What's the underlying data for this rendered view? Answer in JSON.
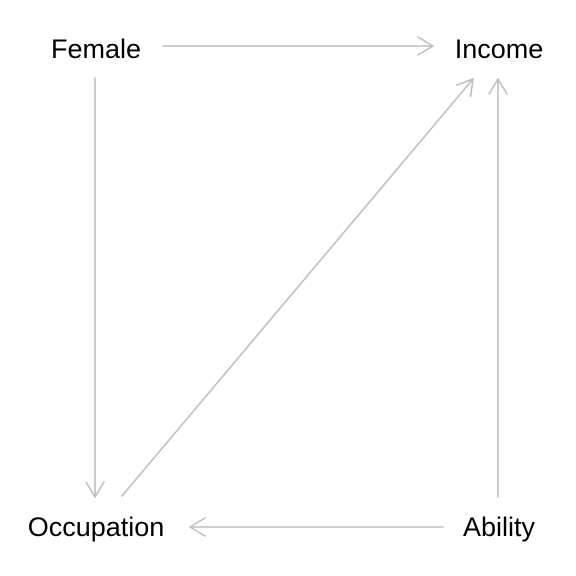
{
  "diagram": {
    "type": "directed-acyclic-graph",
    "nodes": {
      "female": "Female",
      "income": "Income",
      "occupation": "Occupation",
      "ability": "Ability"
    },
    "edges": [
      {
        "from": "female",
        "to": "income"
      },
      {
        "from": "female",
        "to": "occupation"
      },
      {
        "from": "occupation",
        "to": "income"
      },
      {
        "from": "ability",
        "to": "income"
      },
      {
        "from": "ability",
        "to": "occupation"
      }
    ],
    "colors": {
      "edge": "#bebebe",
      "text": "#000000",
      "background": "#ffffff"
    }
  }
}
